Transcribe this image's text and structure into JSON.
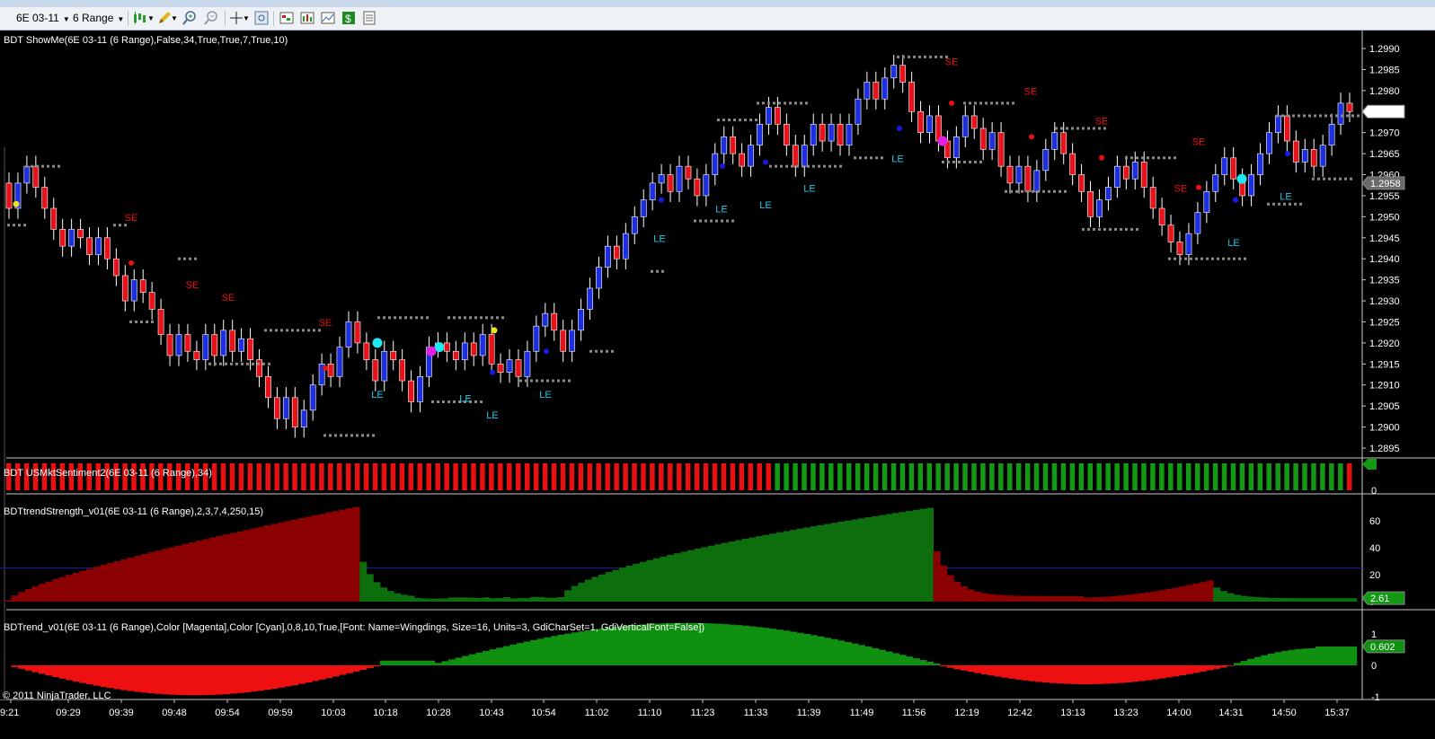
{
  "toolbar": {
    "instrument": "6E 03-11",
    "bar_type": "6 Range",
    "buttons": [
      "candlestick-icon",
      "pencil-icon",
      "zoom-in-icon",
      "zoom-out-icon",
      "crosshair-icon",
      "properties-icon",
      "strategies-icon",
      "indicators-icon",
      "chart-icon",
      "dollar-icon",
      "data-box-icon"
    ]
  },
  "panels": {
    "price": {
      "label": "BDT ShowMe(6E 03-11 (6 Range),False,34,True,True,7,True,10)",
      "y_ticks": [
        "1.2990",
        "1.2985",
        "1.2980",
        "1.2975",
        "1.2970",
        "1.2965",
        "1.2960",
        "1.2955",
        "1.2950",
        "1.2945",
        "1.2940",
        "1.2935",
        "1.2930",
        "1.2925",
        "1.2920",
        "1.2915",
        "1.2910",
        "1.2905",
        "1.2900",
        "1.2895"
      ],
      "last_price": "1.2975",
      "marker_price": "1.2958"
    },
    "sentiment": {
      "label": "BDT USMktSentiment2(6E 03-11 (6 Range),34)",
      "y_ticks": [
        "1",
        "0"
      ]
    },
    "strength": {
      "label": "BDTtrendStrength_v01(6E 03-11 (6 Range),2,3,7,4,250,15)",
      "y_ticks": [
        "60",
        "40",
        "20",
        "0"
      ],
      "last_value": "2.61"
    },
    "trend": {
      "label": "BDTrend_v01(6E 03-11 (6 Range),Color [Magenta],Color [Cyan],0,8,10,True,[Font: Name=Wingdings, Size=16, Units=3, GdiCharSet=1, GdiVerticalFont=False])",
      "y_ticks": [
        "1",
        "0",
        "-1"
      ],
      "last_value": "0.602"
    }
  },
  "x_axis": {
    "ticks": [
      "9:21",
      "09:29",
      "09:39",
      "09:48",
      "09:54",
      "09:59",
      "10:03",
      "10:18",
      "10:28",
      "10:43",
      "10:54",
      "11:02",
      "11:10",
      "11:23",
      "11:33",
      "11:39",
      "11:49",
      "11:56",
      "12:19",
      "12:42",
      "13:13",
      "13:23",
      "14:00",
      "14:31",
      "14:50",
      "15:37"
    ]
  },
  "copyright": "© 2011 NinjaTrader, LLC",
  "signals": {
    "se": "SE",
    "le": "LE"
  },
  "colors": {
    "up_candle": "#1d2fe0",
    "down_candle": "#e8121b",
    "bull": "#0c6e0c",
    "bear": "#8b0000",
    "sentiment_red": "#e81010",
    "sentiment_green": "#139913",
    "trend_red": "#ee1010",
    "trend_green": "#109010",
    "le_text": "#24c8e8",
    "se_text": "#e81010",
    "stops": "#8a8a8a",
    "zero_line": "#1a1aa0"
  }
}
